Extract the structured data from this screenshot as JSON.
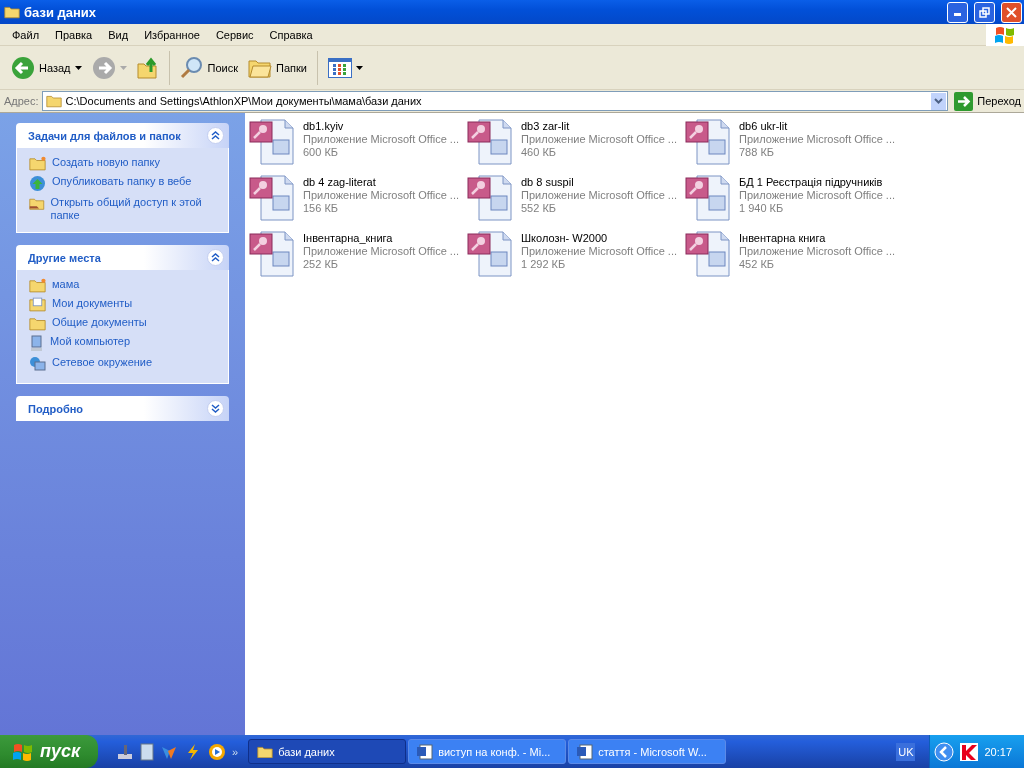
{
  "window": {
    "title": "бази даних"
  },
  "menu": [
    "Файл",
    "Правка",
    "Вид",
    "Избранное",
    "Сервис",
    "Справка"
  ],
  "toolbar": {
    "back": {
      "label": "Назад",
      "disabled": false
    },
    "forward": {
      "disabled": true
    },
    "search": {
      "label": "Поиск"
    },
    "folders": {
      "label": "Папки"
    }
  },
  "address": {
    "label": "Адрес:",
    "value": "C:\\Documents and Settings\\AthlonXP\\Мои документы\\мама\\бази даних",
    "go": "Переход"
  },
  "sidebar": [
    {
      "title": "Задачи для файлов и папок",
      "expanded": true,
      "items": [
        "Создать новую папку",
        "Опубликовать папку в вебе",
        "Открыть общий доступ к этой папке"
      ]
    },
    {
      "title": "Другие места",
      "expanded": true,
      "items": [
        "мама",
        "Мои документы",
        "Общие документы",
        "Мой компьютер",
        "Сетевое окружение"
      ]
    },
    {
      "title": "Подробно",
      "expanded": false
    }
  ],
  "files": [
    {
      "name": "db1.kyiv",
      "type": "Приложение Microsoft Office ...",
      "size": "600 КБ"
    },
    {
      "name": "db3  zar-lit",
      "type": "Приложение Microsoft Office ...",
      "size": "460 КБ"
    },
    {
      "name": "db6 ukr-lit",
      "type": "Приложение Microsoft Office ...",
      "size": "788 КБ"
    },
    {
      "name": "db 4 zag-literat",
      "type": "Приложение Microsoft Office ...",
      "size": "156 КБ"
    },
    {
      "name": "db 8 suspil",
      "type": "Приложение Microsoft Office ...",
      "size": "552 КБ"
    },
    {
      "name": "БД 1 Реєстрація підручників",
      "type": "Приложение Microsoft Office ...",
      "size": "1 940 КБ"
    },
    {
      "name": "Інвентарна_книга",
      "type": "Приложение Microsoft Office ...",
      "size": "252 КБ"
    },
    {
      "name": "Школозн- W2000",
      "type": "Приложение Microsoft Office ...",
      "size": "1 292 КБ"
    },
    {
      "name": "Інвентарна книга",
      "type": "Приложение Microsoft Office ...",
      "size": "452 КБ"
    }
  ],
  "taskbar": {
    "start": "пуск",
    "more": "»",
    "windows": [
      {
        "label": "бази даних",
        "kind": "folder",
        "selected": true
      },
      {
        "label": "виступ на конф. - Mi...",
        "kind": "word",
        "selected": false
      },
      {
        "label": "стаття - Microsoft W...",
        "kind": "word",
        "selected": false
      }
    ],
    "language": "UK",
    "time": "20:17"
  }
}
